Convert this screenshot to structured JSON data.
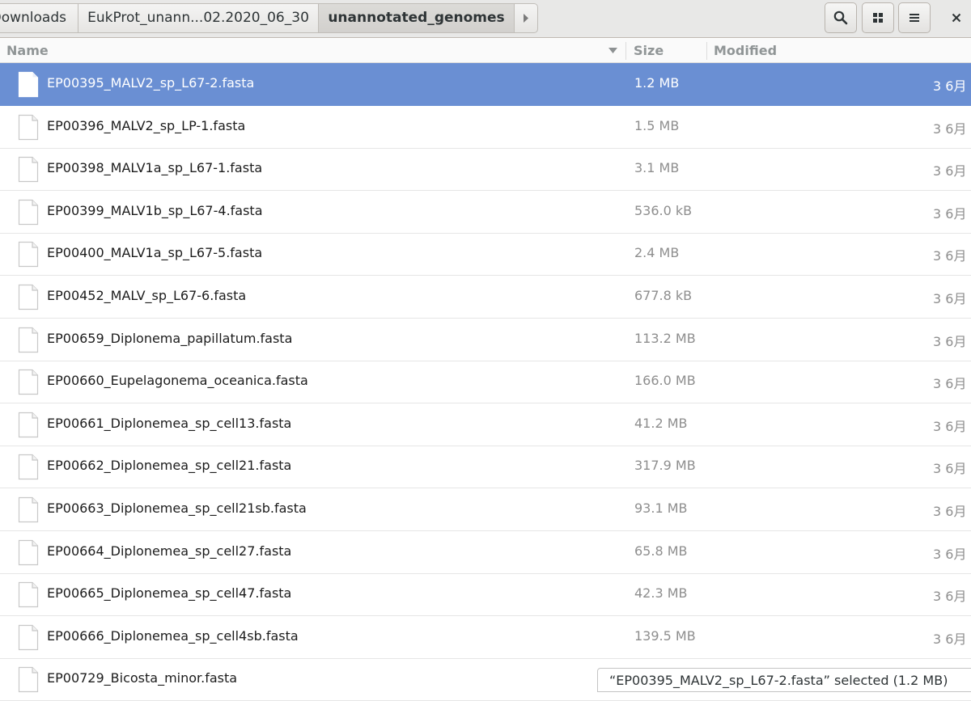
{
  "breadcrumbs": [
    {
      "label": "Downloads"
    },
    {
      "label": "EukProt_unann...02.2020_06_30"
    },
    {
      "label": "unannotated_genomes"
    }
  ],
  "toolbar": {
    "search_icon": "search-icon",
    "view_icon": "grid-view-icon",
    "menu_icon": "hamburger-menu-icon",
    "close_label": "×"
  },
  "columns": {
    "name": "Name",
    "size": "Size",
    "modified": "Modified"
  },
  "files": [
    {
      "name": "EP00395_MALV2_sp_L67-2.fasta",
      "size": "1.2 MB",
      "modified": "3  6月",
      "selected": true
    },
    {
      "name": "EP00396_MALV2_sp_LP-1.fasta",
      "size": "1.5 MB",
      "modified": "3  6月"
    },
    {
      "name": "EP00398_MALV1a_sp_L67-1.fasta",
      "size": "3.1 MB",
      "modified": "3  6月"
    },
    {
      "name": "EP00399_MALV1b_sp_L67-4.fasta",
      "size": "536.0 kB",
      "modified": "3  6月"
    },
    {
      "name": "EP00400_MALV1a_sp_L67-5.fasta",
      "size": "2.4 MB",
      "modified": "3  6月"
    },
    {
      "name": "EP00452_MALV_sp_L67-6.fasta",
      "size": "677.8 kB",
      "modified": "3  6月"
    },
    {
      "name": "EP00659_Diplonema_papillatum.fasta",
      "size": "113.2 MB",
      "modified": "3  6月"
    },
    {
      "name": "EP00660_Eupelagonema_oceanica.fasta",
      "size": "166.0 MB",
      "modified": "3  6月"
    },
    {
      "name": "EP00661_Diplonemea_sp_cell13.fasta",
      "size": "41.2 MB",
      "modified": "3  6月"
    },
    {
      "name": "EP00662_Diplonemea_sp_cell21.fasta",
      "size": "317.9 MB",
      "modified": "3  6月"
    },
    {
      "name": "EP00663_Diplonemea_sp_cell21sb.fasta",
      "size": "93.1 MB",
      "modified": "3  6月"
    },
    {
      "name": "EP00664_Diplonemea_sp_cell27.fasta",
      "size": "65.8 MB",
      "modified": "3  6月"
    },
    {
      "name": "EP00665_Diplonemea_sp_cell47.fasta",
      "size": "42.3 MB",
      "modified": "3  6月"
    },
    {
      "name": "EP00666_Diplonemea_sp_cell4sb.fasta",
      "size": "139.5 MB",
      "modified": "3  6月"
    },
    {
      "name": "EP00729_Bicosta_minor.fasta",
      "size": "",
      "modified": ""
    }
  ],
  "status_text": "“EP00395_MALV2_sp_L67-2.fasta” selected (1.2 MB)",
  "colors": {
    "selection": "#6a8fd3",
    "header_bg": "#e8e8e7"
  }
}
